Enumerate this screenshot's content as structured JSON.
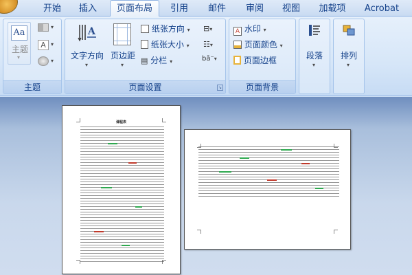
{
  "tabs": [
    {
      "label": "开始"
    },
    {
      "label": "插入"
    },
    {
      "label": "页面布局"
    },
    {
      "label": "引用"
    },
    {
      "label": "邮件"
    },
    {
      "label": "审阅"
    },
    {
      "label": "视图"
    },
    {
      "label": "加载项"
    },
    {
      "label": "Acrobat"
    }
  ],
  "groups": {
    "theme": {
      "label": "主题",
      "theme_button": "主题",
      "aa_label": "Aa",
      "a_label": "A"
    },
    "page_setup": {
      "label": "页面设置",
      "text_direction": "文字方向",
      "margins": "页边距",
      "orientation": "纸张方向",
      "size": "纸张大小",
      "columns": "分栏",
      "hyphen_label": "bā⁻"
    },
    "page_background": {
      "label": "页面背景",
      "watermark": "水印",
      "page_color": "页面颜色",
      "page_borders": "页面边框"
    },
    "paragraph": {
      "label": "段落"
    },
    "arrange": {
      "label": "排列"
    }
  },
  "document": {
    "page1_title": "课程表"
  }
}
